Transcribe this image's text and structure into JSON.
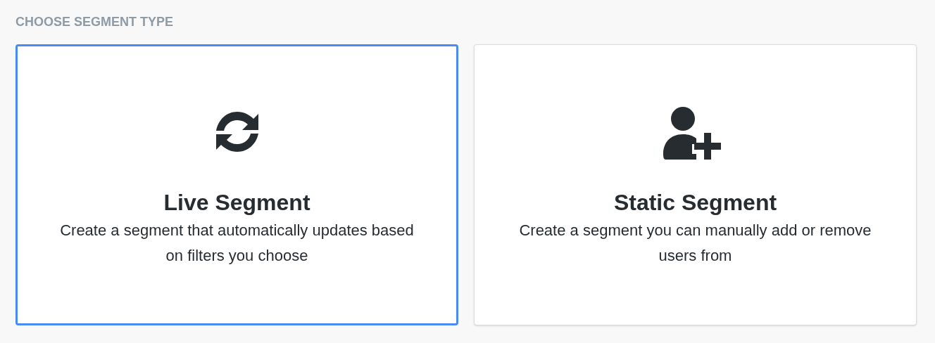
{
  "heading": "CHOOSE SEGMENT TYPE",
  "options": [
    {
      "kind": "live",
      "title": "Live Segment",
      "description": "Create a segment that automatically updates based on filters you choose",
      "selected": true
    },
    {
      "kind": "static",
      "title": "Static Segment",
      "description": "Create a segment you can manually add or remove users from",
      "selected": false
    }
  ]
}
